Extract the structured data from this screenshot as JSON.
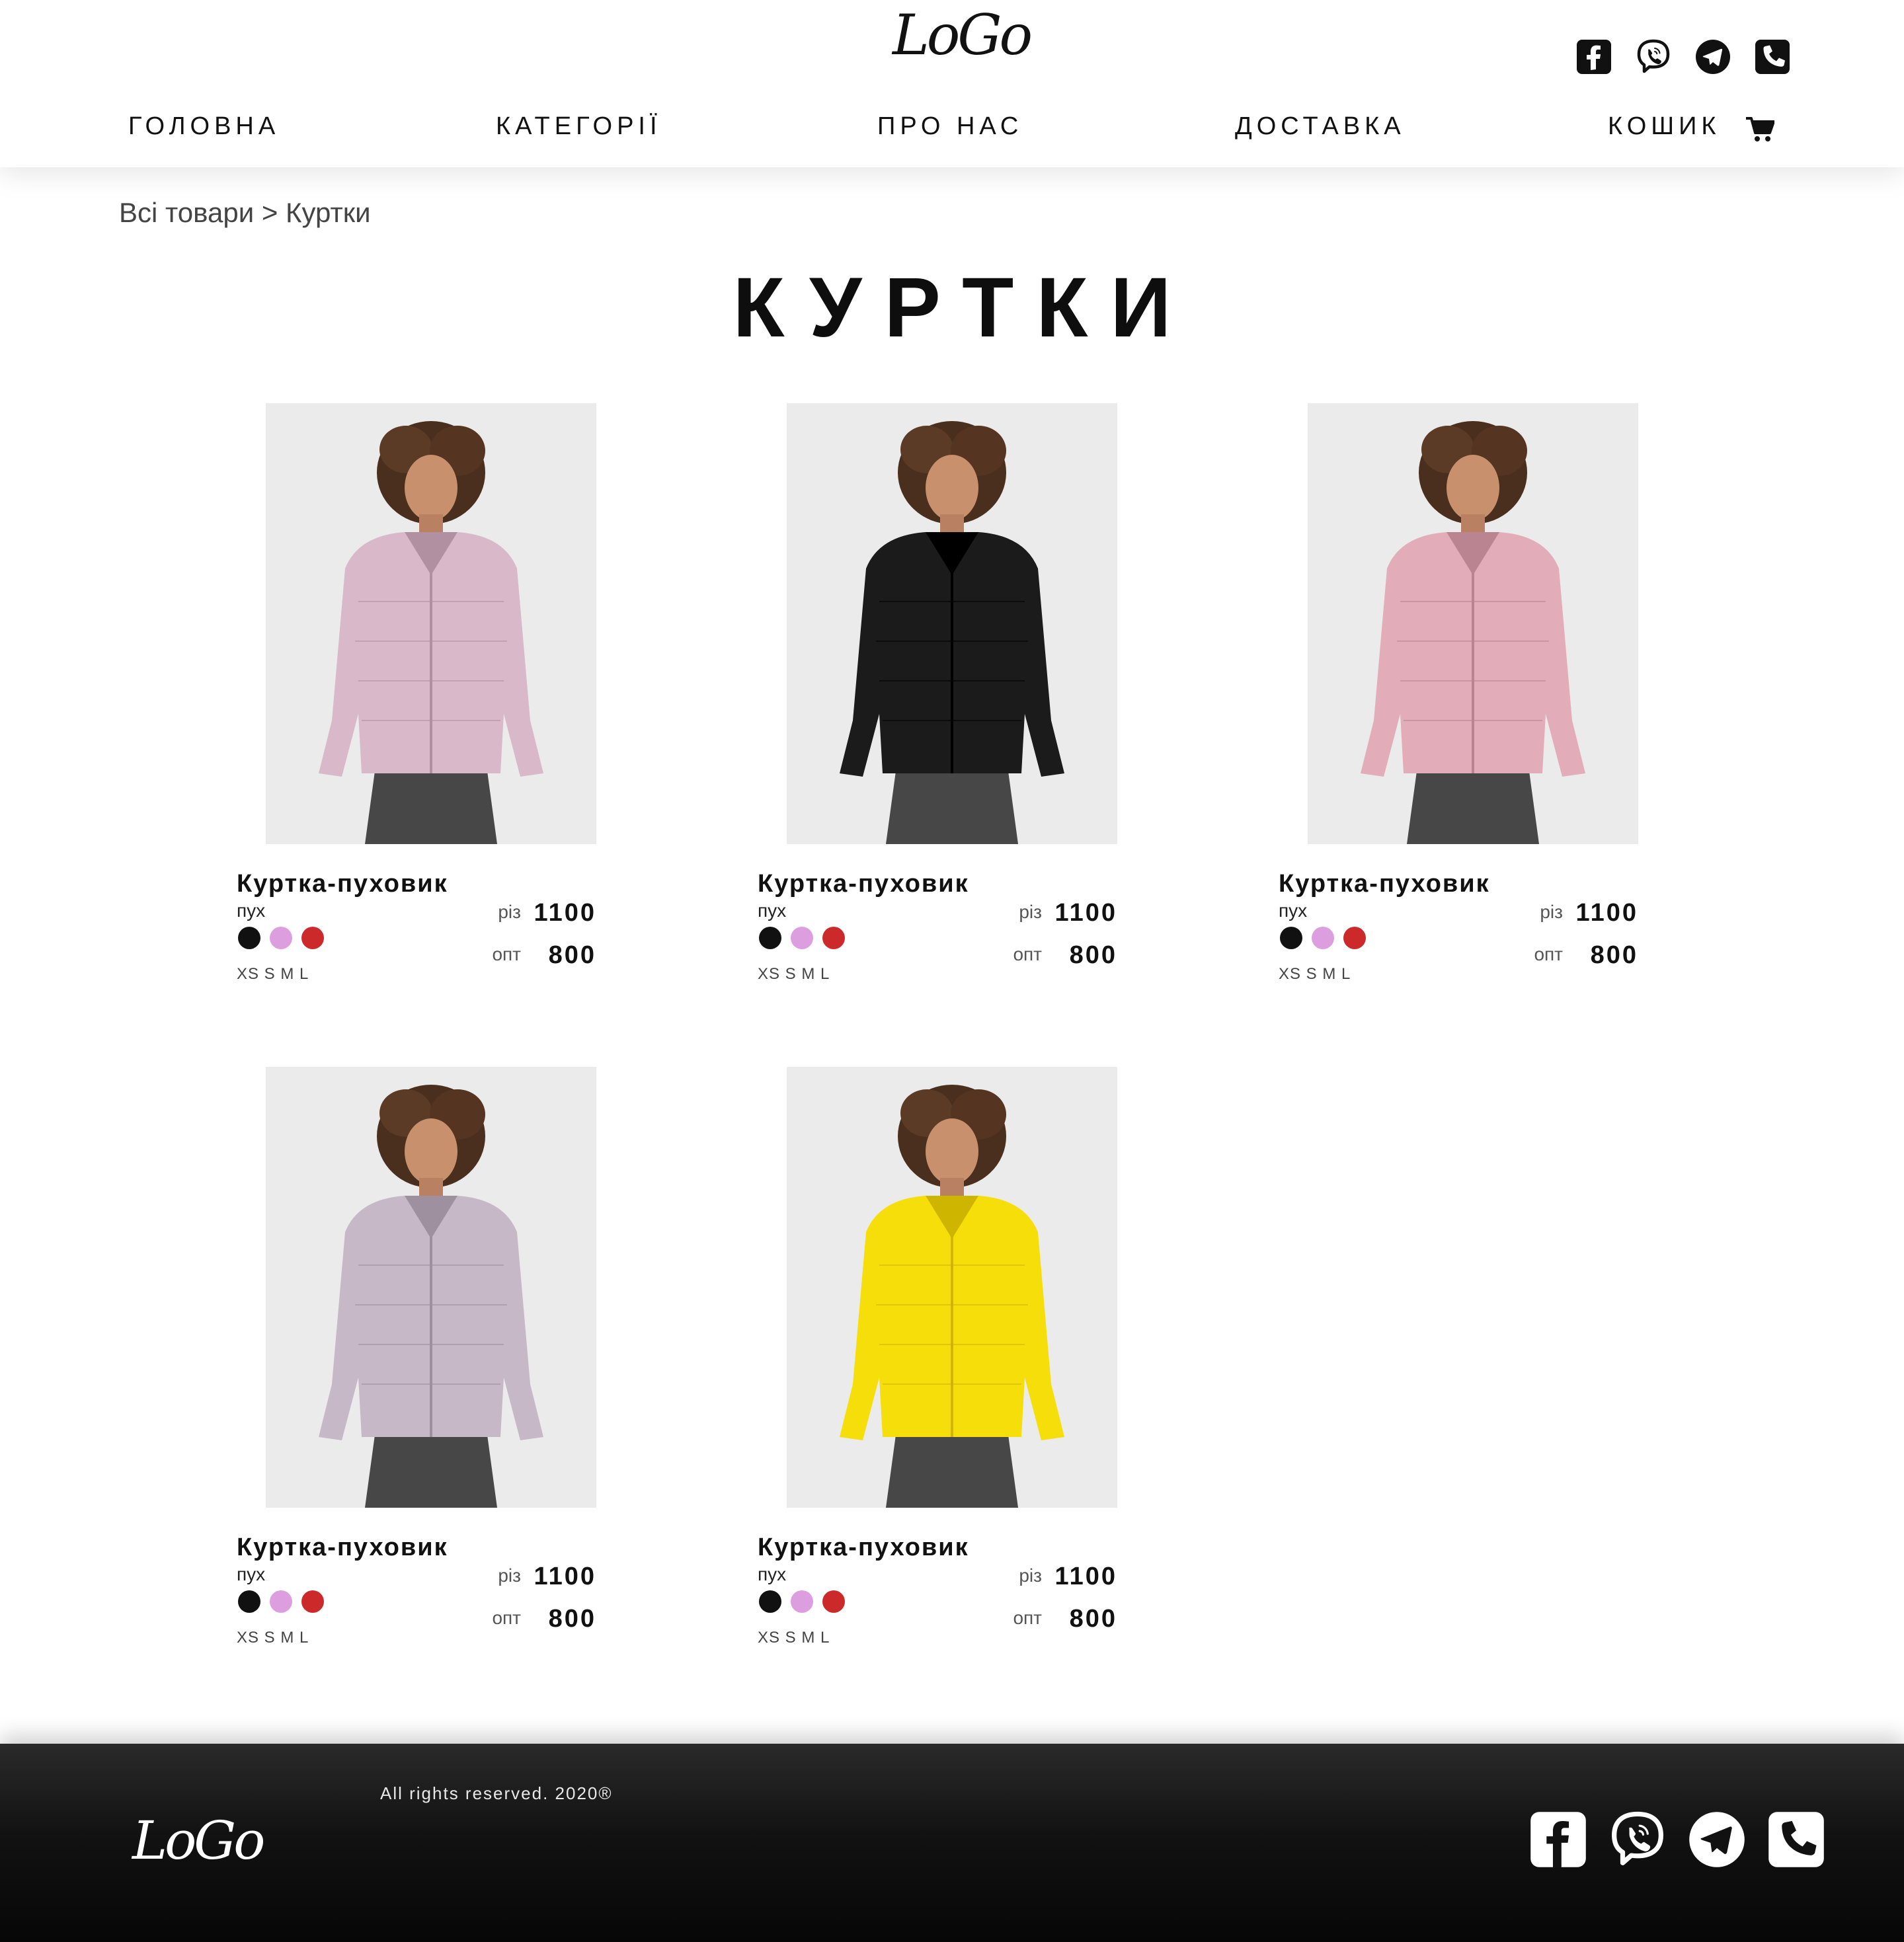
{
  "header": {
    "logo": "LoGo",
    "social_icons": [
      "facebook-icon",
      "viber-icon",
      "telegram-icon",
      "phone-icon"
    ],
    "nav": {
      "home": "ГОЛОВНА",
      "categories": "КАТЕГОРІЇ",
      "about": "ПРО НАС",
      "delivery": "ДОСТАВКА",
      "cart": "КОШИК"
    },
    "cart_icon": "cart-icon"
  },
  "breadcrumb": {
    "root": "Всі товари",
    "separator": ">",
    "current": "Куртки"
  },
  "page_title": "КУРТКИ",
  "products": [
    {
      "name": "Куртка-пуховик",
      "material": "пух",
      "sizes": "XS S M L",
      "retail_label": "різ",
      "retail_price": "1100",
      "wholesale_label": "опт",
      "wholesale_price": "800",
      "jacket_color": "#d9b9c9"
    },
    {
      "name": "Куртка-пуховик",
      "material": "пух",
      "sizes": "XS S M L",
      "retail_label": "різ",
      "retail_price": "1100",
      "wholesale_label": "опт",
      "wholesale_price": "800",
      "jacket_color": "#1b1b1b"
    },
    {
      "name": "Куртка-пуховик",
      "material": "пух",
      "sizes": "XS S M L",
      "retail_label": "різ",
      "retail_price": "1100",
      "wholesale_label": "опт",
      "wholesale_price": "800",
      "jacket_color": "#e2adb8"
    },
    {
      "name": "Куртка-пуховик",
      "material": "пух",
      "sizes": "XS S M L",
      "retail_label": "різ",
      "retail_price": "1100",
      "wholesale_label": "опт",
      "wholesale_price": "800",
      "jacket_color": "#c7b8c8"
    },
    {
      "name": "Куртка-пуховик",
      "material": "пух",
      "sizes": "XS S M L",
      "retail_label": "різ",
      "retail_price": "1100",
      "wholesale_label": "опт",
      "wholesale_price": "800",
      "jacket_color": "#f6de0a"
    }
  ],
  "color_swatches": [
    "#111111",
    "#dd9ee0",
    "#cc2a2a"
  ],
  "footer": {
    "logo": "LoGo",
    "copyright": "All rights reserved. 2020®",
    "social_icons": [
      "facebook-icon",
      "viber-icon",
      "telegram-icon",
      "phone-icon"
    ]
  }
}
